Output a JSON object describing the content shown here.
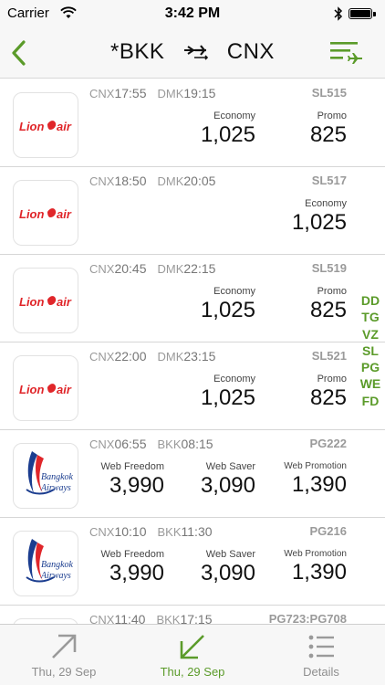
{
  "status": {
    "carrier": "Carrier",
    "time": "3:42 PM"
  },
  "nav": {
    "origin": "*BKK",
    "destination": "CNX"
  },
  "colors": {
    "accent": "#5b9b2a",
    "lionair": "#e0262a",
    "bangkok_blue": "#1b3d8f"
  },
  "flights": [
    {
      "from": "CNX",
      "dep": "17:55",
      "to": "DMK",
      "arr": "19:15",
      "flight_no": "SL515",
      "airline": "lionair",
      "fares": [
        {
          "name": "Economy",
          "price": "1,025"
        },
        {
          "name": "Promo",
          "price": "825"
        }
      ]
    },
    {
      "from": "CNX",
      "dep": "18:50",
      "to": "DMK",
      "arr": "20:05",
      "flight_no": "SL517",
      "airline": "lionair",
      "fares": [
        {
          "name": "Economy",
          "price": "1,025"
        }
      ]
    },
    {
      "from": "CNX",
      "dep": "20:45",
      "to": "DMK",
      "arr": "22:15",
      "flight_no": "SL519",
      "airline": "lionair",
      "fares": [
        {
          "name": "Economy",
          "price": "1,025"
        },
        {
          "name": "Promo",
          "price": "825"
        }
      ]
    },
    {
      "from": "CNX",
      "dep": "22:00",
      "to": "DMK",
      "arr": "23:15",
      "flight_no": "SL521",
      "airline": "lionair",
      "fares": [
        {
          "name": "Economy",
          "price": "1,025"
        },
        {
          "name": "Promo",
          "price": "825"
        }
      ]
    },
    {
      "from": "CNX",
      "dep": "06:55",
      "to": "BKK",
      "arr": "08:15",
      "flight_no": "PG222",
      "airline": "bangkok",
      "fares": [
        {
          "name": "Web Freedom",
          "price": "3,990"
        },
        {
          "name": "Web Saver",
          "price": "3,090"
        },
        {
          "name": "Web Promotion",
          "price": "1,390"
        }
      ]
    },
    {
      "from": "CNX",
      "dep": "10:10",
      "to": "BKK",
      "arr": "11:30",
      "flight_no": "PG216",
      "airline": "bangkok",
      "fares": [
        {
          "name": "Web Freedom",
          "price": "3,990"
        },
        {
          "name": "Web Saver",
          "price": "3,090"
        },
        {
          "name": "Web Promotion",
          "price": "1,390"
        }
      ]
    },
    {
      "from": "CNX",
      "dep": "11:40",
      "to": "BKK",
      "arr": "17:15",
      "flight_no": "PG723:PG708",
      "airline": "bangkok",
      "fares": []
    }
  ],
  "logos": {
    "lionair_text": "Lion air",
    "bangkok_line1": "Bangkok",
    "bangkok_line2": "Airways"
  },
  "side_index": [
    "DD",
    "TG",
    "VZ",
    "SL",
    "PG",
    "WE",
    "FD"
  ],
  "tabs": [
    {
      "label": "Thu, 29 Sep",
      "icon": "arrow-up-right-icon",
      "active": false
    },
    {
      "label": "Thu, 29 Sep",
      "icon": "arrow-down-left-icon",
      "active": true
    },
    {
      "label": "Details",
      "icon": "list-icon",
      "active": false
    }
  ]
}
